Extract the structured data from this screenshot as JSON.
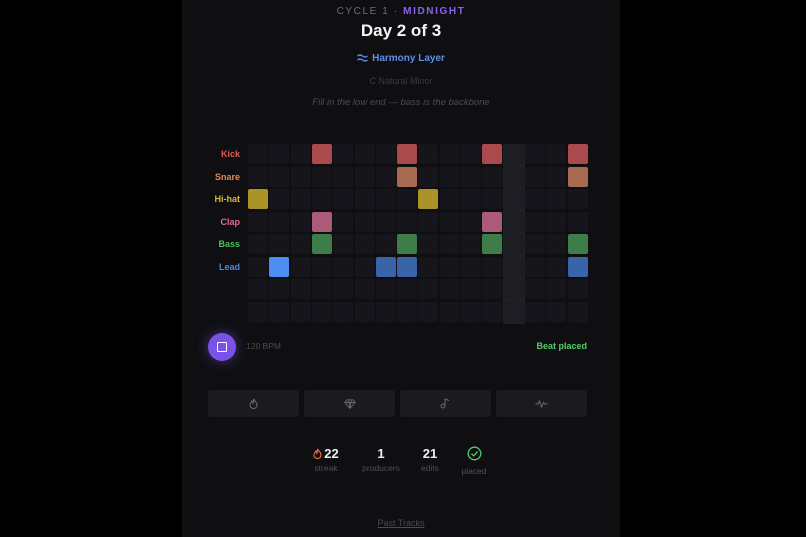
{
  "header": {
    "cycle": "CYCLE 1",
    "separator": "·",
    "theme": "MIDNIGHT",
    "title": "Day 2 of 3",
    "layer": "Harmony Layer",
    "scale": "C Natural Minor",
    "hint": "Fill in the low end — bass is the backbone"
  },
  "sequencer": {
    "steps": 16,
    "rows_total": 8,
    "highlight_step": 13,
    "tracks": [
      {
        "name": "Kick",
        "label_color": "#e05a5a",
        "color": "#ab4a4c",
        "steps": [
          4,
          8,
          12,
          16
        ]
      },
      {
        "name": "Snare",
        "label_color": "#e08a58",
        "color": "#a86a50",
        "steps": [
          8,
          16
        ]
      },
      {
        "name": "Hi-hat",
        "label_color": "#d9b43e",
        "color": "#ab9328",
        "steps": [
          1,
          9
        ]
      },
      {
        "name": "Clap",
        "label_color": "#e06a9a",
        "color": "#ab5a77",
        "steps": [
          4,
          12
        ]
      },
      {
        "name": "Bass",
        "label_color": "#4fbf5f",
        "color": "#3e7c4a",
        "steps": [
          4,
          8,
          12,
          16
        ]
      },
      {
        "name": "Lead",
        "label_color": "#4a88e8",
        "color": "#3a64aa",
        "active_color": "#4d8ef5",
        "active_step": 2,
        "steps": [
          2,
          7,
          8,
          16
        ]
      }
    ]
  },
  "transport": {
    "bpm": "120 BPM",
    "status": "Beat placed",
    "play_icon": "stop-square-icon"
  },
  "tools": [
    {
      "icon": "flame-icon"
    },
    {
      "icon": "diamond-icon"
    },
    {
      "icon": "music-note-icon"
    },
    {
      "icon": "wave-icon"
    }
  ],
  "stats": [
    {
      "value": "22",
      "label": "streak",
      "icon": "flame-icon"
    },
    {
      "value": "1",
      "label": "producers"
    },
    {
      "value": "21",
      "label": "edits"
    },
    {
      "value": "",
      "label": "placed",
      "icon": "check-circle-icon"
    }
  ],
  "footer": {
    "past_tracks": "Past Tracks"
  },
  "colors": {
    "accent": "#7b52e8",
    "success": "#4fcf6a",
    "panel": "#0f0f12",
    "empty_cell": "#15151b"
  }
}
